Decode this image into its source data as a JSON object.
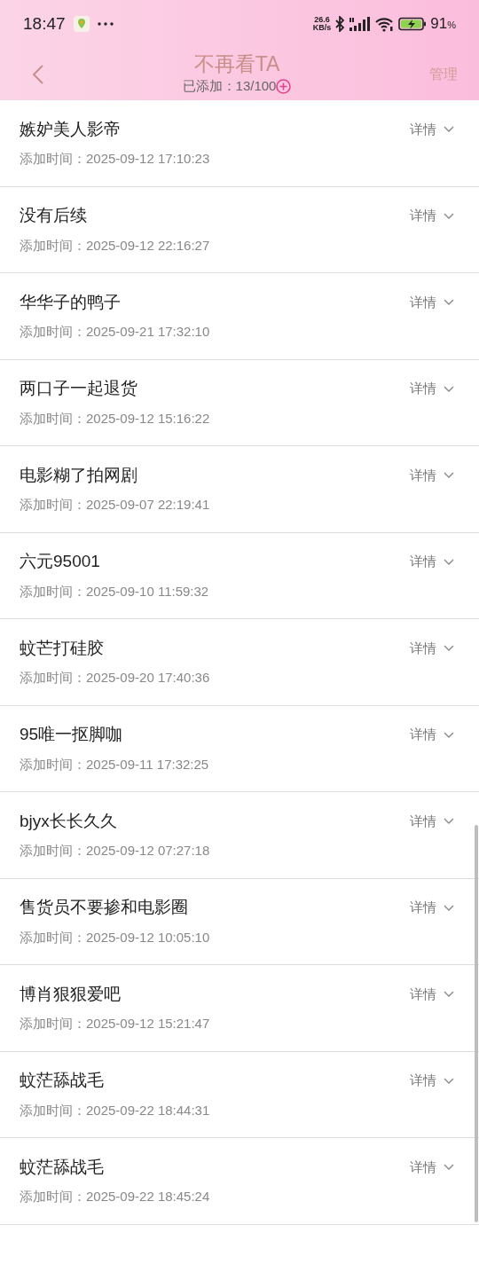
{
  "status_bar": {
    "time": "18:47",
    "network_speed": "26.6",
    "network_unit": "KB/s",
    "battery": "91",
    "battery_unit": "%"
  },
  "header": {
    "title": "不再看TA",
    "subtitle": "已添加：13/100",
    "action": "管理"
  },
  "items": [
    {
      "name": "嫉妒美人影帝",
      "details": "详情",
      "expanded": false,
      "added": "添加时间：2025-09-12 17:10:23"
    },
    {
      "name": "没有后续",
      "details": "详情",
      "expanded": false,
      "added": "添加时间：2025-09-12 22:16:27"
    },
    {
      "name": "华华子的鸭子",
      "details": "详情",
      "expanded": false,
      "added": "添加时间：2025-09-21 17:32:10"
    },
    {
      "name": "两口子一起退货",
      "details": "详情",
      "expanded": false,
      "added": "添加时间：2025-09-12 15:16:22"
    },
    {
      "name": "电影糊了拍网剧",
      "details": "详情",
      "expanded": false,
      "added": "添加时间：2025-09-07 22:19:41"
    },
    {
      "name": "六元95001",
      "details": "详情",
      "expanded": false,
      "added": "添加时间：2025-09-10 11:59:32"
    },
    {
      "name": "蚊芒打硅胶",
      "details": "详情",
      "expanded": false,
      "added": "添加时间：2025-09-20 17:40:36"
    },
    {
      "name": "95唯一抠脚咖",
      "details": "详情",
      "expanded": false,
      "added": "添加时间：2025-09-11 17:32:25"
    },
    {
      "name": "bjyx长长久久",
      "details": "详情",
      "expanded": false,
      "added": "添加时间：2025-09-12 07:27:18"
    },
    {
      "name": "售货员不要掺和电影圈",
      "details": "详情",
      "expanded": false,
      "added": "添加时间：2025-09-12 10:05:10"
    },
    {
      "name": "博肖狠狠爱吧",
      "details": "详情",
      "expanded": false,
      "added": "添加时间：2025-09-12 15:21:47"
    },
    {
      "name": "蚊茫舔战毛",
      "details": "详情",
      "expanded": false,
      "added": "添加时间：2025-09-22 18:44:31"
    },
    {
      "name": "蚊茫舔战毛",
      "details": "详情",
      "expanded": false,
      "added": "添加时间：2025-09-22 18:45:24"
    }
  ]
}
